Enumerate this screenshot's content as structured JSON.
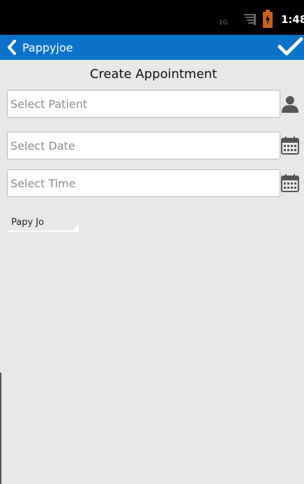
{
  "status_bar": {
    "network": "1G",
    "time": "1:48"
  },
  "action_bar": {
    "back_label": "Pappyjoe",
    "icons": {
      "back": "chevron-left-icon",
      "confirm": "checkmark-icon"
    },
    "color": "#0b72c9"
  },
  "page": {
    "title": "Create Appointment"
  },
  "form": {
    "patient": {
      "placeholder": "Select Patient",
      "value": "",
      "icon": "person-icon"
    },
    "date": {
      "placeholder": "Select Date",
      "value": "",
      "icon": "calendar-icon"
    },
    "time": {
      "placeholder": "Select Time",
      "value": "",
      "icon": "calendar-icon"
    },
    "doctor_spinner": {
      "selected": "Papy Jo"
    }
  }
}
